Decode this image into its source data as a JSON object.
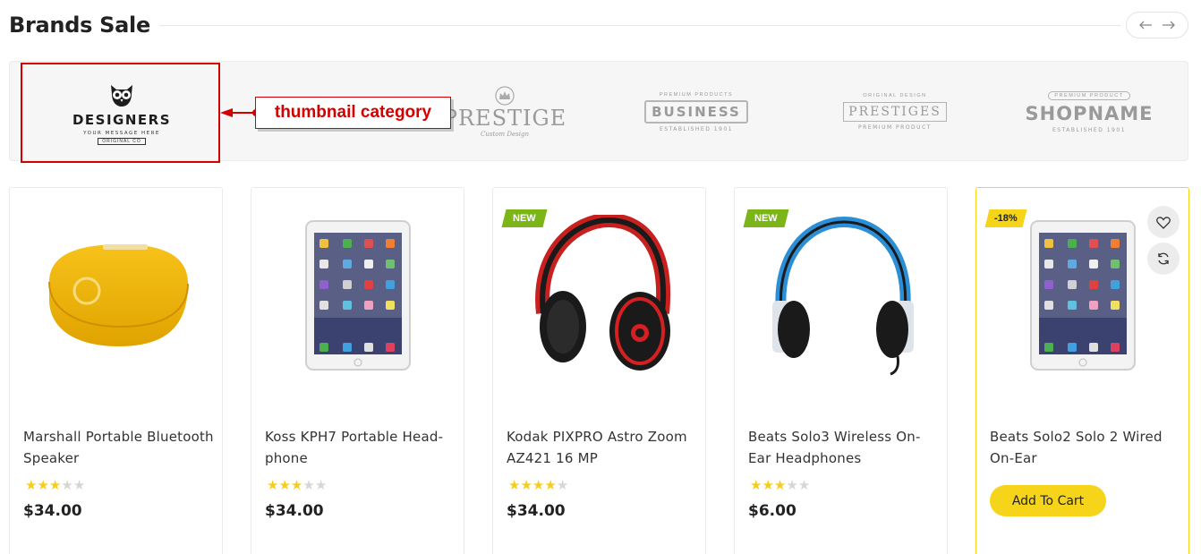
{
  "section": {
    "title": "Brands Sale",
    "nav": {
      "prev_icon": "arrow-left-icon",
      "next_icon": "arrow-right-icon"
    }
  },
  "brands": [
    {
      "name": "DESIGNERS",
      "tagline": "YOUR MESSAGE HERE",
      "badge": "ORIGINAL CO",
      "icon": "owl-icon"
    },
    {
      "name": "PRESTIGE",
      "tagline": "Custom Design",
      "icon": "crown-icon"
    },
    {
      "name": "BUSINESS",
      "top": "PREMIUM PRODUCTS",
      "tagline": "ESTABLISHED 1901"
    },
    {
      "name": "PRESTIGES",
      "top": "ORIGINAL DESIGN",
      "tagline": "PREMIUM PRODUCT"
    },
    {
      "name": "SHOPNAME",
      "top": "PREMIUM PRODUCT",
      "tagline": "ESTABLISHED 1901"
    }
  ],
  "annotation": {
    "label": "thumbnail category",
    "color": "#d40000"
  },
  "products": [
    {
      "title": "Marshall Portable Bluetooth Speaker",
      "price": "$34.00",
      "rating": 3,
      "badge": "",
      "image": "yellow-speaker"
    },
    {
      "title": "Koss KPH7 Portable Head-phone",
      "price": "$34.00",
      "rating": 3,
      "badge": "",
      "image": "tablet"
    },
    {
      "title": "Kodak PIXPRO Astro Zoom AZ421 16 MP",
      "price": "$34.00",
      "rating": 4,
      "badge": "NEW",
      "image": "red-headphones"
    },
    {
      "title": "Beats Solo3 Wireless On-Ear Headphones",
      "price": "$6.00",
      "rating": 3,
      "badge": "NEW",
      "image": "blue-headphones"
    },
    {
      "title": "Beats Solo2 Solo 2 Wired On-Ear",
      "price": "",
      "rating": null,
      "badge": "-18%",
      "image": "tablet",
      "add_to_cart": "Add To Cart",
      "hovered": true
    }
  ],
  "colors": {
    "accent": "#f6d41a",
    "new_badge": "#7cb518",
    "star_on": "#f6cd1e",
    "star_off": "#d6d6d6"
  }
}
